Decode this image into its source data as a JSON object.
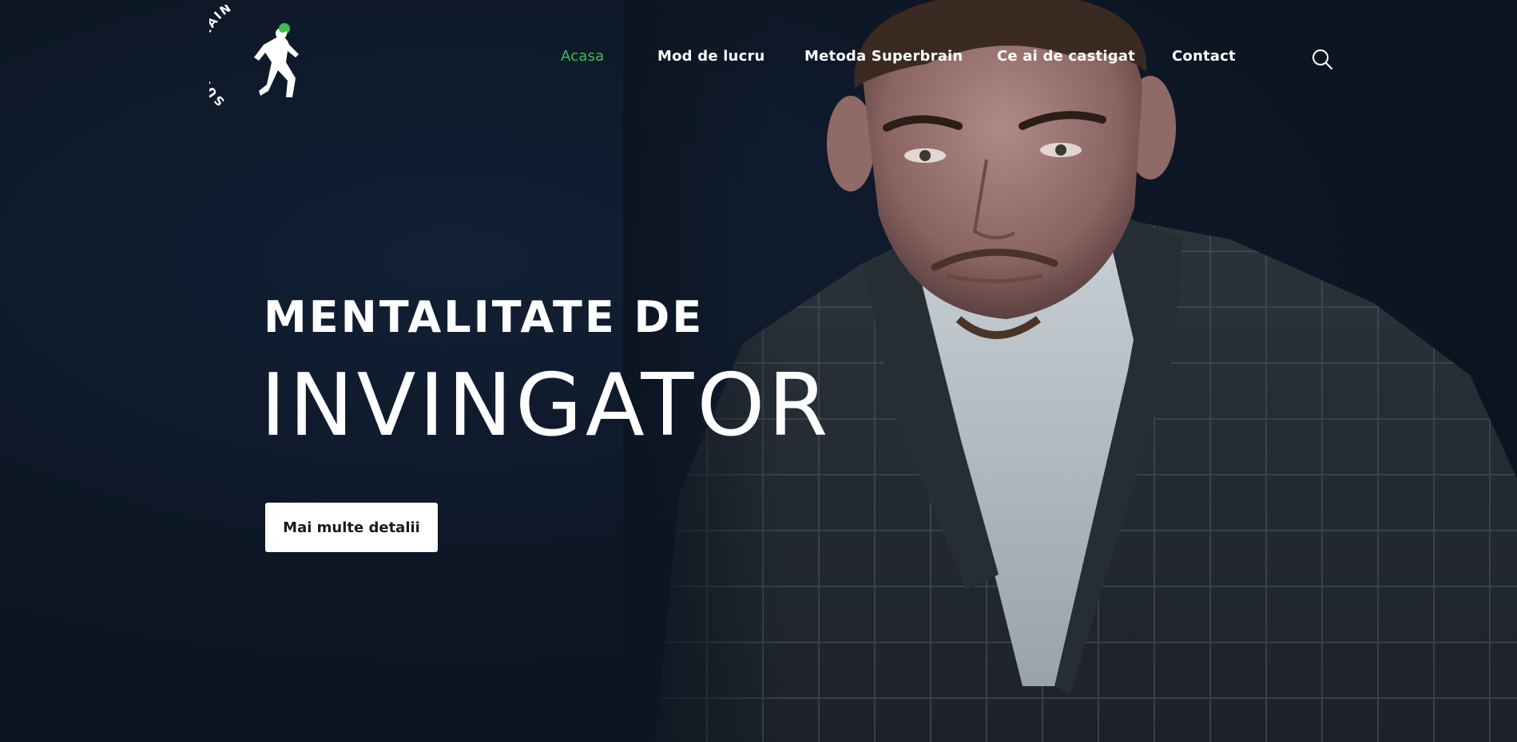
{
  "brand": {
    "logo_text": "SUPER BRAIN",
    "accent_color": "#3fbf4a"
  },
  "nav": {
    "items": [
      {
        "label": "Acasa",
        "active": true
      },
      {
        "label": "Mod de lucru",
        "active": false
      },
      {
        "label": "Metoda Superbrain",
        "active": false
      },
      {
        "label": "Ce ai de castigat",
        "active": false
      },
      {
        "label": "Contact",
        "active": false
      }
    ],
    "search_icon": "search-icon"
  },
  "hero": {
    "headline_top": "MENTALITATE DE",
    "headline_main": "INVINGATOR",
    "cta_label": "Mai multe detalii",
    "background_color": "#0c1522"
  }
}
